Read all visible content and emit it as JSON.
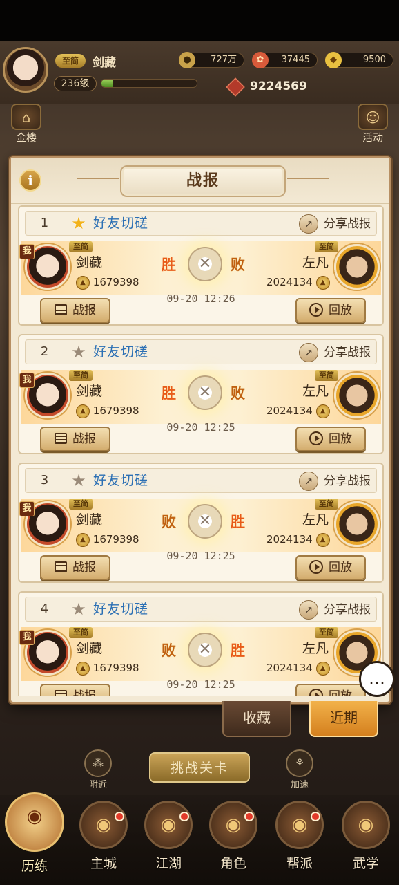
{
  "hud": {
    "rank": "至简",
    "player_name": "剑藏",
    "level": "236级",
    "xp_fraction": 0.12,
    "copper": "727万",
    "jade": "37445",
    "gold": "9500",
    "power": "9224569",
    "left_icon_label": "金楼",
    "right_icon_label": "活动"
  },
  "dialog": {
    "title": "战报",
    "info_label": "i"
  },
  "reports": [
    {
      "index": "1",
      "starred": true,
      "category": "好友切磋",
      "share_label": "分享战报",
      "me_tag": "我",
      "left_rank": "至简",
      "left_name": "剑藏",
      "left_score": "1679398",
      "left_result": "胜",
      "right_rank": "至简",
      "right_name": "左凡",
      "right_score": "2024134",
      "right_result": "败",
      "time": "09-20 12:26",
      "report_btn": "战报",
      "replay_btn": "回放"
    },
    {
      "index": "2",
      "starred": false,
      "category": "好友切磋",
      "share_label": "分享战报",
      "me_tag": "我",
      "left_rank": "至简",
      "left_name": "剑藏",
      "left_score": "1679398",
      "left_result": "胜",
      "right_rank": "至简",
      "right_name": "左凡",
      "right_score": "2024134",
      "right_result": "败",
      "time": "09-20 12:25",
      "report_btn": "战报",
      "replay_btn": "回放"
    },
    {
      "index": "3",
      "starred": false,
      "category": "好友切磋",
      "share_label": "分享战报",
      "me_tag": "我",
      "left_rank": "至简",
      "left_name": "剑藏",
      "left_score": "1679398",
      "left_result": "败",
      "right_rank": "至简",
      "right_name": "左凡",
      "right_score": "2024134",
      "right_result": "胜",
      "time": "09-20 12:25",
      "report_btn": "战报",
      "replay_btn": "回放"
    },
    {
      "index": "4",
      "starred": false,
      "category": "好友切磋",
      "share_label": "分享战报",
      "me_tag": "我",
      "left_rank": "至简",
      "left_name": "剑藏",
      "left_score": "1679398",
      "left_result": "败",
      "right_rank": "至简",
      "right_name": "左凡",
      "right_score": "2024134",
      "right_result": "胜",
      "time": "09-20 12:25",
      "report_btn": "战报",
      "replay_btn": "回放"
    }
  ],
  "tabs": {
    "favorites": "收藏",
    "recent": "近期"
  },
  "lobby": {
    "nearby": "附近",
    "challenge": "挑战关卡",
    "speed": "加速"
  },
  "nav": [
    {
      "label": "历练",
      "icon": "training-icon",
      "active": true,
      "badge": false
    },
    {
      "label": "主城",
      "icon": "city-icon",
      "active": false,
      "badge": true
    },
    {
      "label": "江湖",
      "icon": "jianghu-icon",
      "active": false,
      "badge": true
    },
    {
      "label": "角色",
      "icon": "character-icon",
      "active": false,
      "badge": true
    },
    {
      "label": "帮派",
      "icon": "guild-icon",
      "active": false,
      "badge": true
    },
    {
      "label": "武学",
      "icon": "martial-arts-icon",
      "active": false,
      "badge": false
    }
  ],
  "colors": {
    "win": "#e85a18",
    "category": "#2b6fb4",
    "accent": "#d4801e"
  }
}
